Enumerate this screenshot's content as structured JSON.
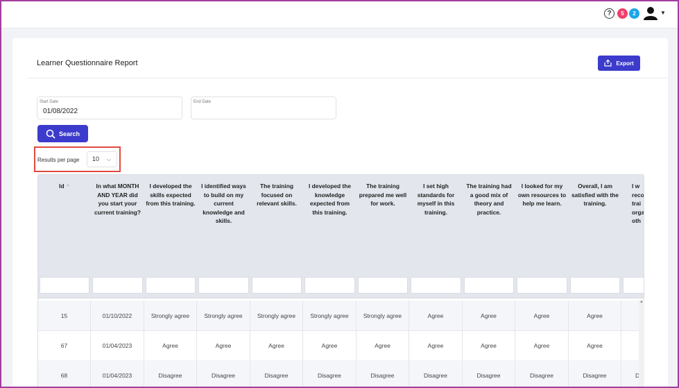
{
  "header": {
    "help_icon": "question-circle-icon",
    "badge_red": "5",
    "badge_blue": "2",
    "colors": {
      "badge_red": "#ef3f6b",
      "badge_blue": "#1da5e8",
      "accent": "#3c3bcc",
      "highlight": "#e04a3f"
    }
  },
  "page": {
    "title": "Learner Questionnaire Report",
    "export_label": "Export"
  },
  "filters": {
    "start_label": "Start Date",
    "start_value": "01/08/2022",
    "end_label": "End Date",
    "end_value": "",
    "search_label": "Search"
  },
  "pagination": {
    "results_label": "Results per page",
    "results_value": "10"
  },
  "table": {
    "columns": [
      "Id",
      "In what MONTH AND YEAR did you start your current training?",
      "I developed the skills expected from this training.",
      "I identified ways to build on my current knowledge and skills.",
      "The training focused on relevant skills.",
      "I developed the knowledge expected from this training.",
      "The training prepared me well for work.",
      "I set high standards for myself in this training.",
      "The training had a good mix of theory and practice.",
      "I looked for my own resources to help me learn.",
      "Overall, I am satisfied with the training.",
      "I w recom trai organi oth"
    ],
    "rows": [
      [
        "15",
        "01/10/2022",
        "Strongly agree",
        "Strongly agree",
        "Strongly agree",
        "Strongly agree",
        "Strongly agree",
        "Agree",
        "Agree",
        "Agree",
        "Agree",
        ""
      ],
      [
        "67",
        "01/04/2023",
        "Agree",
        "Agree",
        "Agree",
        "Agree",
        "Agree",
        "Agree",
        "Agree",
        "Agree",
        "Agree",
        ""
      ],
      [
        "68",
        "01/04/2023",
        "Disagree",
        "Disagree",
        "Disagree",
        "Disagree",
        "Disagree",
        "Disagree",
        "Disagree",
        "Disagree",
        "Disagree",
        "D"
      ]
    ]
  }
}
